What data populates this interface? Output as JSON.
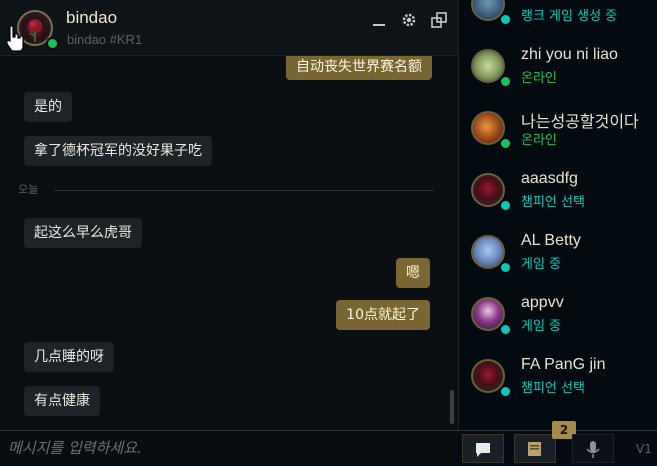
{
  "chat": {
    "header": {
      "name": "bindao",
      "tag": "bindao #KR1",
      "minimize_icon": "minimize-icon",
      "settings_icon": "gear-icon",
      "popout_icon": "popout-icon"
    },
    "messages": [
      {
        "side": "out",
        "text": "自动丧失世界赛名额"
      },
      {
        "side": "in",
        "text": "是的"
      },
      {
        "side": "in",
        "text": "拿了德杯冠军的没好果子吃"
      },
      {
        "side": "in",
        "text": "起这么早么虎哥"
      },
      {
        "side": "out",
        "text": "嗯"
      },
      {
        "side": "out",
        "text": "10点就起了"
      },
      {
        "side": "in",
        "text": "几点睡的呀"
      },
      {
        "side": "in",
        "text": "有点健康"
      }
    ],
    "date_divider": "오늘",
    "input": {
      "placeholder": "메시지를 입력하세요."
    }
  },
  "friends": [
    {
      "name": "",
      "status": "랭크 게임 생성 중",
      "state": "ingame"
    },
    {
      "name": "zhi you ni liao",
      "status": "온라인",
      "state": "online"
    },
    {
      "name": "나는성공할것이다",
      "status": "온라인",
      "state": "online"
    },
    {
      "name": "aaasdfg",
      "status": "챔피언 선택",
      "state": "ingame"
    },
    {
      "name": "AL Betty",
      "status": "게임 중",
      "state": "ingame"
    },
    {
      "name": "appvv",
      "status": "게임 중",
      "state": "ingame"
    },
    {
      "name": "FA PanG jin",
      "status": "챔피언 선택",
      "state": "ingame"
    }
  ],
  "bottom_bar": {
    "notification_count": "2",
    "version": "V1"
  },
  "colors": {
    "online": "#19c25e",
    "ingame": "#0ac8b9",
    "outgoing_bubble": "#7a6632",
    "incoming_bubble": "#1e2328"
  }
}
